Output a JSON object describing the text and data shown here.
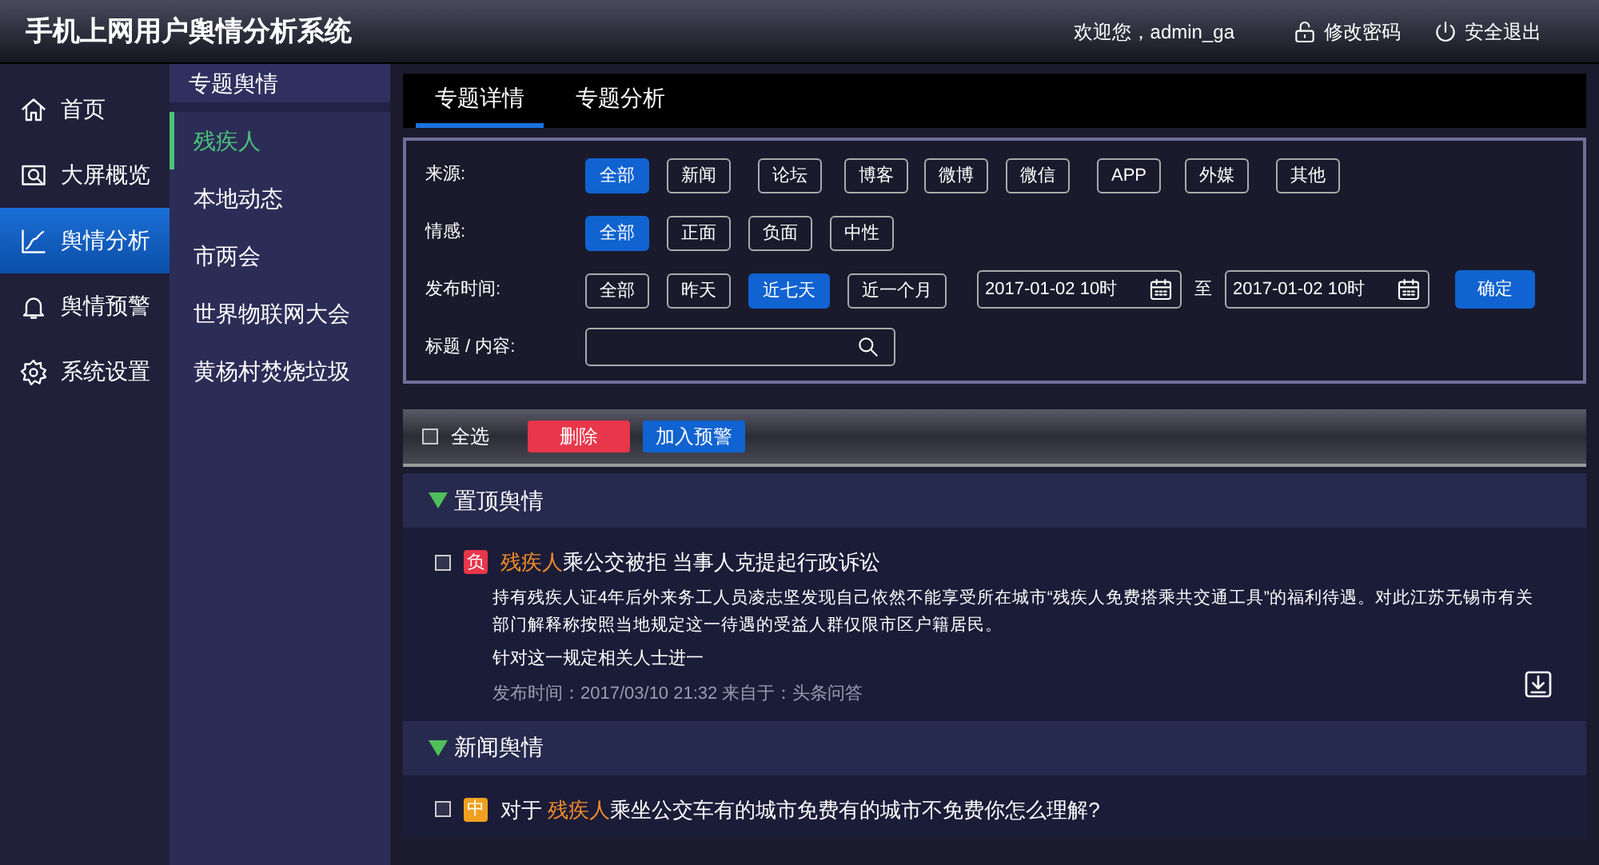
{
  "header": {
    "title": "手机上网用户舆情分析系统",
    "welcome": "欢迎您，admin_ga",
    "actions": [
      {
        "kind": "lock",
        "label": "修改密码"
      },
      {
        "kind": "power",
        "label": "安全退出"
      }
    ]
  },
  "nav": [
    {
      "kind": "home",
      "label": "首页",
      "selected": false
    },
    {
      "kind": "screen",
      "label": "大屏概览",
      "selected": false
    },
    {
      "kind": "chart",
      "label": "舆情分析",
      "selected": true
    },
    {
      "kind": "bell",
      "label": "舆情预警",
      "selected": false
    },
    {
      "kind": "gear",
      "label": "系统设置",
      "selected": false
    }
  ],
  "topics": {
    "heading": "专题舆情",
    "items": [
      {
        "label": "残疾人",
        "selected": true
      },
      {
        "label": "本地动态",
        "selected": false
      },
      {
        "label": "市两会",
        "selected": false
      },
      {
        "label": "世界物联网大会",
        "selected": false
      },
      {
        "label": "黄杨村焚烧垃圾",
        "selected": false
      }
    ]
  },
  "tabs": [
    {
      "label": "专题详情",
      "selected": true
    },
    {
      "label": "专题分析",
      "selected": false
    }
  ],
  "filters": {
    "source": {
      "label": "来源:",
      "options": [
        {
          "label": "全部",
          "selected": true
        },
        {
          "label": "新闻",
          "selected": false
        },
        {
          "label": "论坛",
          "selected": false
        },
        {
          "label": "博客",
          "selected": false
        },
        {
          "label": "微博",
          "selected": false
        },
        {
          "label": "微信",
          "selected": false
        },
        {
          "label": "APP",
          "selected": false
        },
        {
          "label": "外媒",
          "selected": false
        },
        {
          "label": "其他",
          "selected": false
        }
      ]
    },
    "sentiment": {
      "label": "情感:",
      "options": [
        {
          "label": "全部",
          "selected": true
        },
        {
          "label": "正面",
          "selected": false
        },
        {
          "label": "负面",
          "selected": false
        },
        {
          "label": "中性",
          "selected": false
        }
      ]
    },
    "time": {
      "label": "发布时间:",
      "options": [
        {
          "label": "全部",
          "selected": false
        },
        {
          "label": "昨天",
          "selected": false
        },
        {
          "label": "近七天",
          "selected": true
        },
        {
          "label": "近一个月",
          "selected": false
        }
      ],
      "from": "2017-01-02  10时",
      "separator": "至",
      "to": "2017-01-02  10时",
      "confirm": "确定"
    },
    "keyword": {
      "label": "标题 / 内容:"
    }
  },
  "toolbar": {
    "select_all": {
      "label": "全选",
      "checked": false
    },
    "delete": "删除",
    "add_alert": "加入预警"
  },
  "sections": [
    {
      "title": "置顶舆情",
      "expanded": true,
      "articles": [
        {
          "checked": false,
          "badge": "负",
          "color": "#e8364a",
          "title": [
            {
              "text": "残疾人",
              "highlight": true
            },
            {
              "text": "乘公交被拒 当事人克提起行政诉讼",
              "highlight": false
            }
          ],
          "summary": "持有残疾人证4年后外来务工人员凌志坚发现自己依然不能享受所在城市“残疾人免费搭乘共交通工具”的福利待遇。对此江苏无锡市有关部门解释称按照当地规定这一待遇的受益人群仅限市区户籍居民。",
          "more": "针对这一规定相关人士进一",
          "meta": "发布时间：2017/03/10 21:32 来自于：头条问答"
        }
      ]
    },
    {
      "title": "新闻舆情",
      "expanded": true,
      "articles": [
        {
          "checked": false,
          "badge": "中",
          "color": "#f0a020",
          "title": [
            {
              "text": "对于 ",
              "highlight": false
            },
            {
              "text": "残疾人",
              "highlight": true
            },
            {
              "text": "乘坐公交车有的城市免费有的城市不免费你怎么理解?",
              "highlight": false
            }
          ]
        }
      ]
    }
  ]
}
